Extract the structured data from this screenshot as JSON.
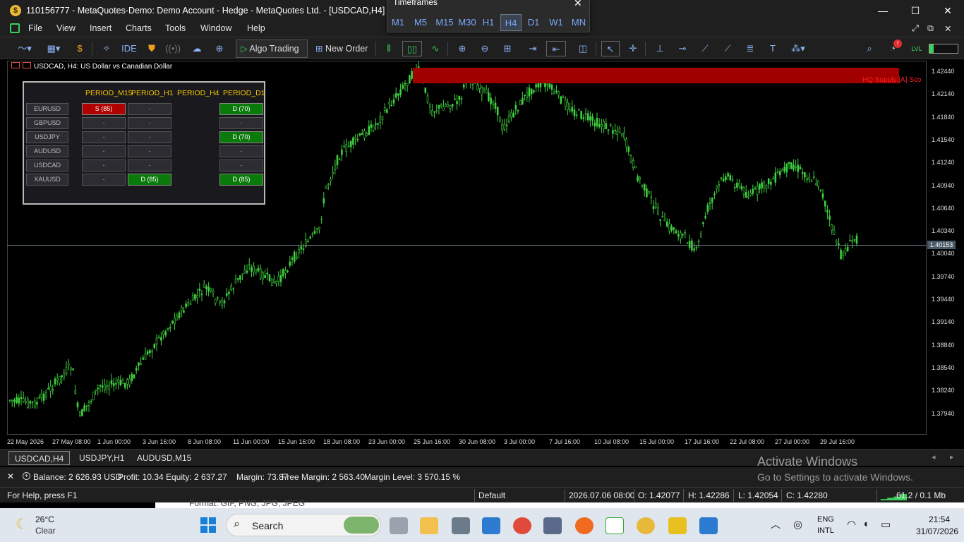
{
  "window": {
    "title": "110156777 - MetaQuotes-Demo: Demo Account - Hedge - MetaQuotes Ltd. - [USDCAD,H4]",
    "min": "—",
    "max": "☐",
    "close": "✕"
  },
  "timeframes_panel": {
    "title": "Timeframes",
    "close": "✕",
    "items": [
      "M1",
      "M5",
      "M15",
      "M30",
      "H1",
      "H4",
      "D1",
      "W1",
      "MN"
    ],
    "active": "H4"
  },
  "menu": {
    "items": [
      "File",
      "View",
      "Insert",
      "Charts",
      "Tools",
      "Window",
      "Help"
    ],
    "right": [
      "⤢",
      "⧉",
      "✕"
    ]
  },
  "toolbar": {
    "ide": "IDE",
    "algo": "Algo Trading",
    "new_order": "New Order"
  },
  "chart": {
    "header": "USDCAD, H4:  US Dollar vs Canadian Dollar",
    "symbol": "USDCAD",
    "current_price": "1.40153",
    "supply_label": "HQ Supply [A] Sco",
    "price_ticks": [
      "1.42440",
      "1.42140",
      "1.41840",
      "1.41540",
      "1.41240",
      "1.40940",
      "1.40640",
      "1.40340",
      "1.40040",
      "1.39740",
      "1.39440",
      "1.39140",
      "1.38840",
      "1.38540",
      "1.38240",
      "1.37940"
    ],
    "time_ticks": [
      "22 May 2026",
      "27 May 08:00",
      "1 Jun 00:00",
      "3 Jun 16:00",
      "8 Jun 08:00",
      "11 Jun 00:00",
      "15 Jun 16:00",
      "18 Jun 08:00",
      "23 Jun 00:00",
      "25 Jun 16:00",
      "30 Jun 08:00",
      "3 Jul 00:00",
      "7 Jul 16:00",
      "10 Jul 08:00",
      "15 Jul 00:00",
      "17 Jul 16:00",
      "22 Jul 08:00",
      "27 Jul 00:00",
      "29 Jul 16:00"
    ]
  },
  "dashboard": {
    "headers": [
      "PERIOD_M15",
      "PERIOD_H1",
      "PERIOD_H4",
      "PERIOD_D1"
    ],
    "rows": [
      {
        "symbol": "EURUSD",
        "m15": "S (85)",
        "h1": "-",
        "h4": "",
        "d1": "D (70)",
        "m15c": "red",
        "h1c": "",
        "d1c": "green"
      },
      {
        "symbol": "GBPUSD",
        "m15": "-",
        "h1": "-",
        "h4": "",
        "d1": "-",
        "m15c": "",
        "h1c": "",
        "d1c": ""
      },
      {
        "symbol": "USDJPY",
        "m15": "-",
        "h1": "-",
        "h4": "",
        "d1": "D (70)",
        "m15c": "",
        "h1c": "",
        "d1c": "green"
      },
      {
        "symbol": "AUDUSD",
        "m15": "-",
        "h1": "-",
        "h4": "",
        "d1": "-",
        "m15c": "",
        "h1c": "",
        "d1c": ""
      },
      {
        "symbol": "USDCAD",
        "m15": "-",
        "h1": "-",
        "h4": "",
        "d1": "-",
        "m15c": "",
        "h1c": "",
        "d1c": ""
      },
      {
        "symbol": "XAUUSD",
        "m15": "-",
        "h1": "D (85)",
        "h4": "",
        "d1": "D (85)",
        "m15c": "",
        "h1c": "green",
        "d1c": "green"
      }
    ]
  },
  "chart_tabs": [
    "USDCAD,H4",
    "USDJPY,H1",
    "AUDUSD,M15"
  ],
  "account": {
    "close": "✕",
    "balance": "Balance: 2 626.93 USD",
    "profit": "Profit: 10.34",
    "equity": "Equity: 2 637.27",
    "margin": "Margin: 73.87",
    "free_margin": "Free Margin: 2 563.40",
    "margin_level": "Margin Level: 3 570.15 %"
  },
  "watermark": {
    "line1": "Activate Windows",
    "line2": "Go to Settings to activate Windows."
  },
  "status": {
    "help": "For Help, press F1",
    "profile": "Default",
    "datetime": "2026.07.06 08:00",
    "open": "O: 1.42077",
    "high": "H: 1.42286",
    "low": "L: 1.42054",
    "close": "C: 1.42280",
    "traffic": "61.2 / 0.1 Mb"
  },
  "background_text": "Format: GIF, PNG, JPG, JPEG",
  "taskbar": {
    "weather_temp": "26°C",
    "weather_desc": "Clear",
    "search": "Search",
    "lang1": "ENG",
    "lang2": "INTL",
    "time": "21:54",
    "date": "31/07/2026"
  }
}
